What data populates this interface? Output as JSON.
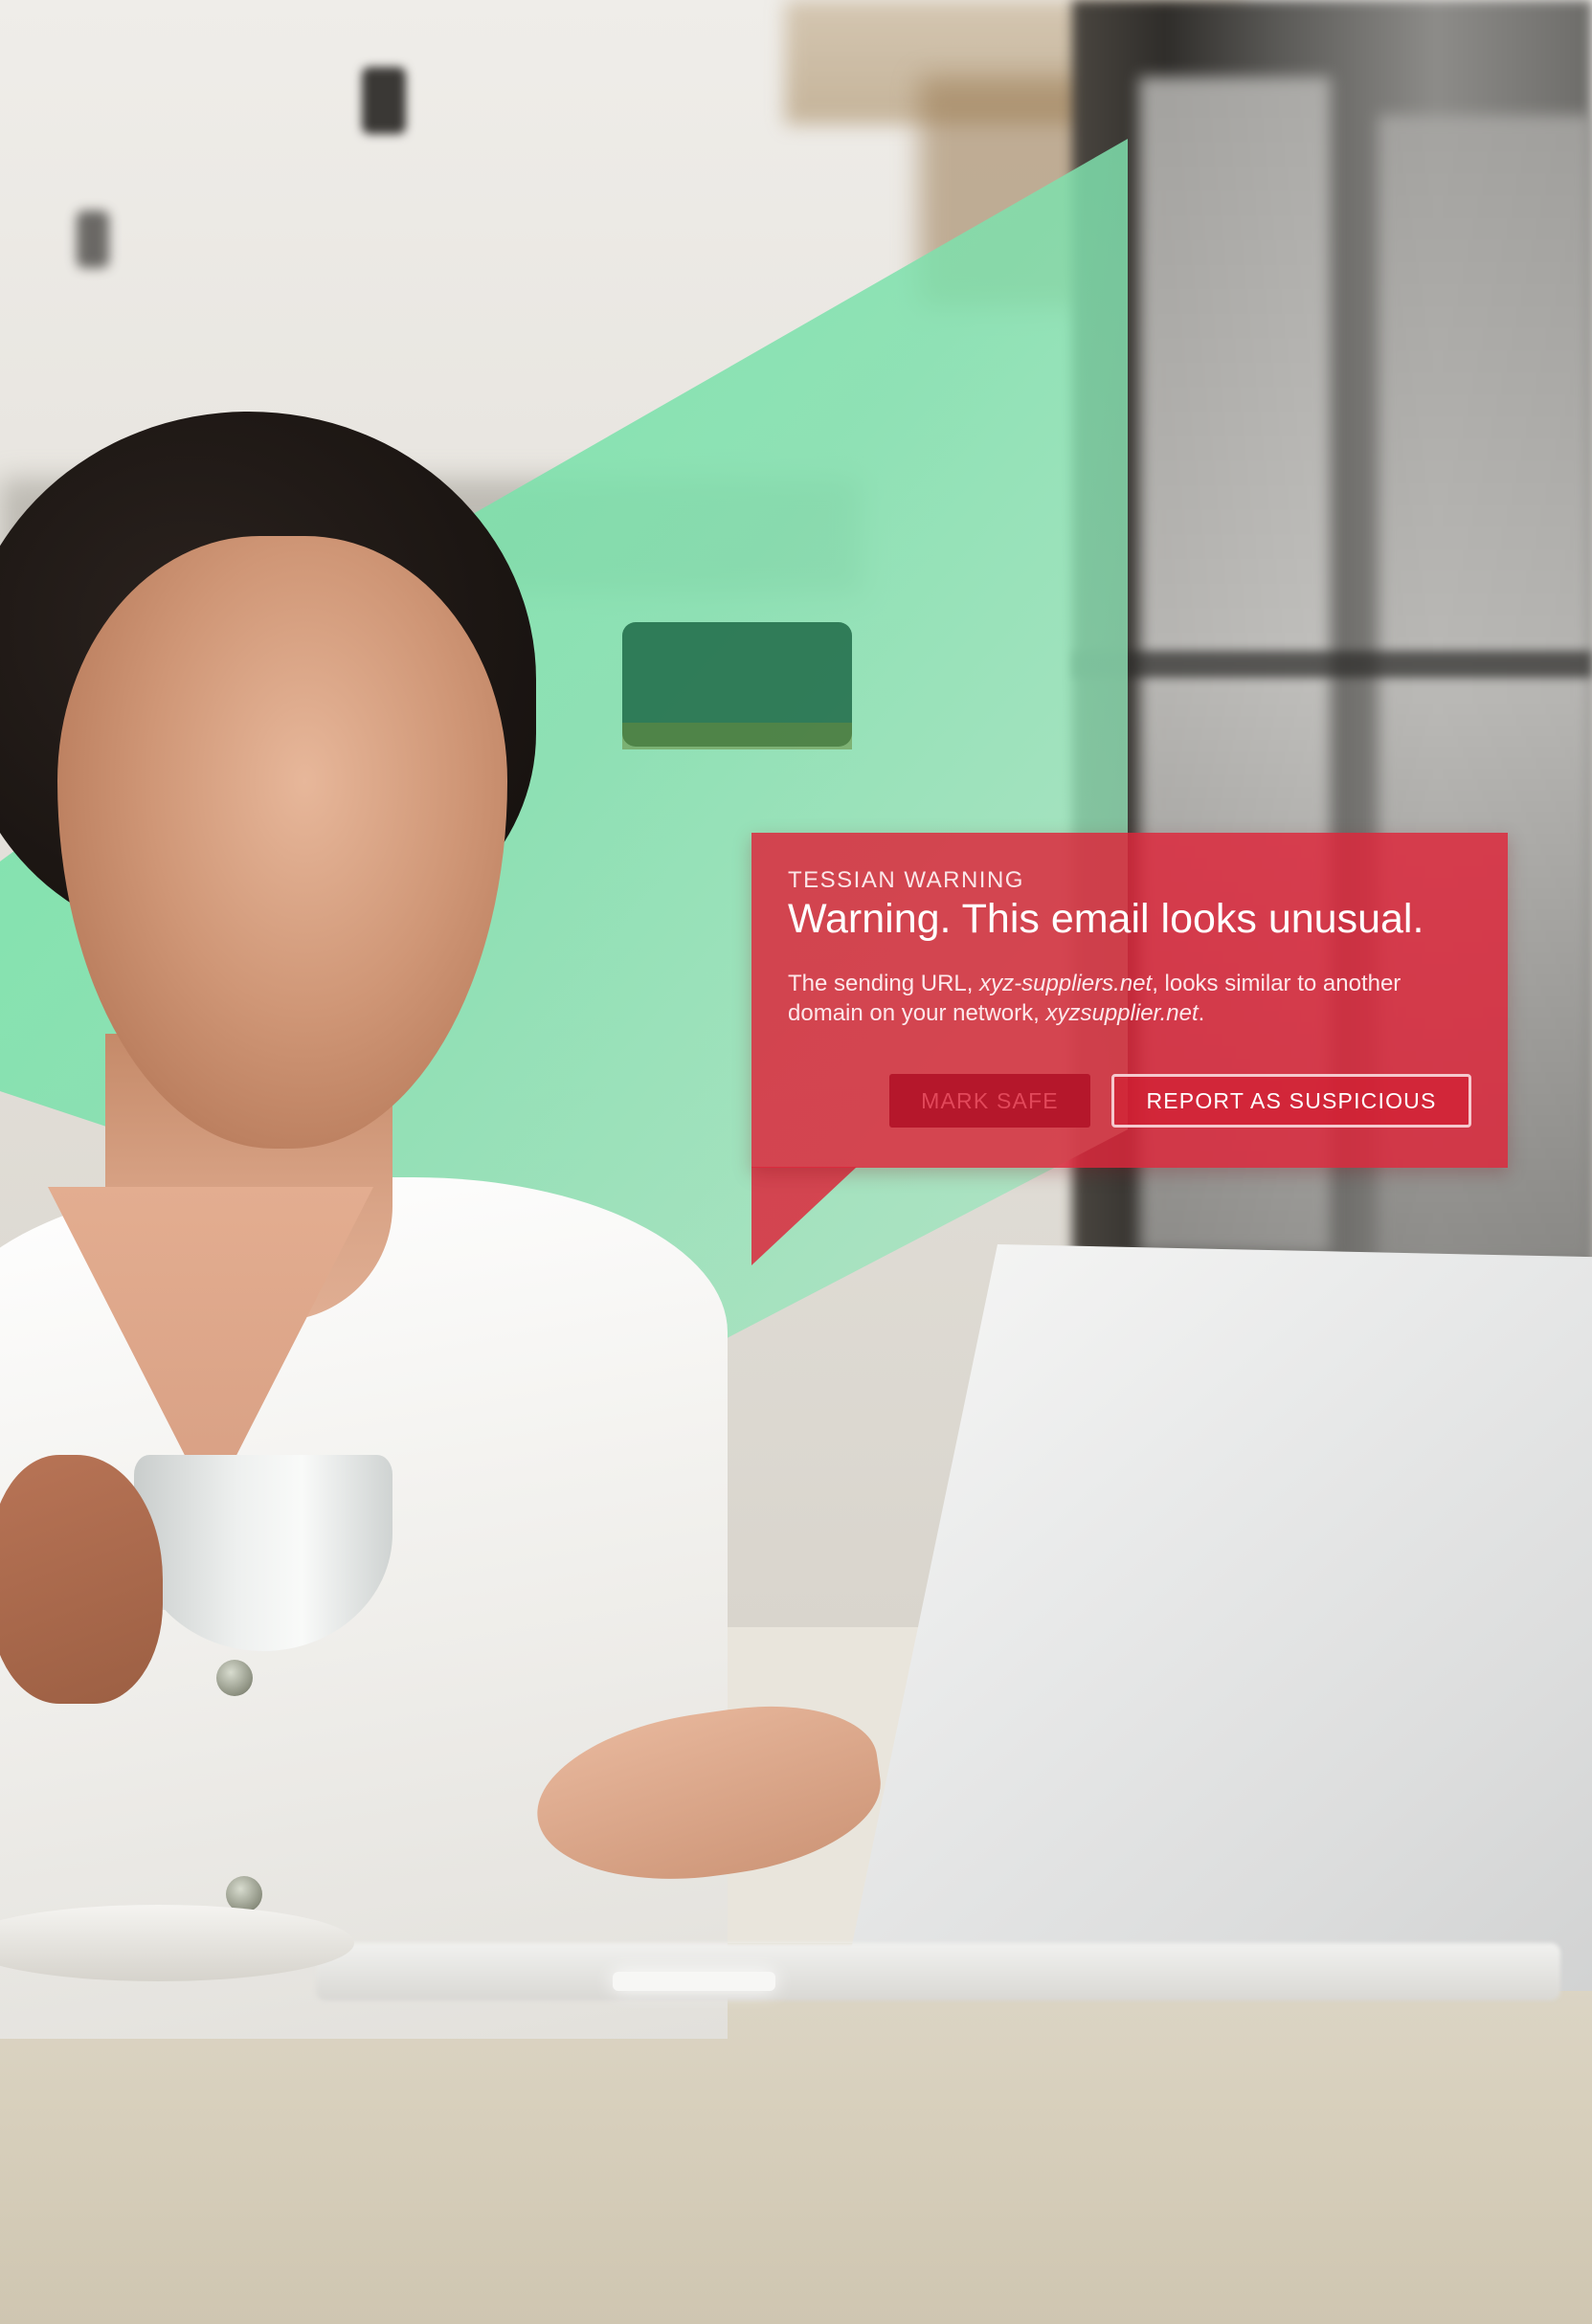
{
  "warning": {
    "label": "TESSIAN WARNING",
    "title": "Warning. This email looks unusual.",
    "body_prefix": "The sending URL, ",
    "sender_domain": "xyz-suppliers.net",
    "body_middle": ", looks similar to another domain on your network, ",
    "lookalike_domain": "xyzsupplier.net",
    "body_suffix": ".",
    "buttons": {
      "mark_safe": "MARK SAFE",
      "report": "REPORT AS SUSPICIOUS"
    }
  },
  "colors": {
    "warning_red": "#dc263a",
    "mark_safe_bg": "#b5172b",
    "projection_green": "#5fe39a"
  }
}
